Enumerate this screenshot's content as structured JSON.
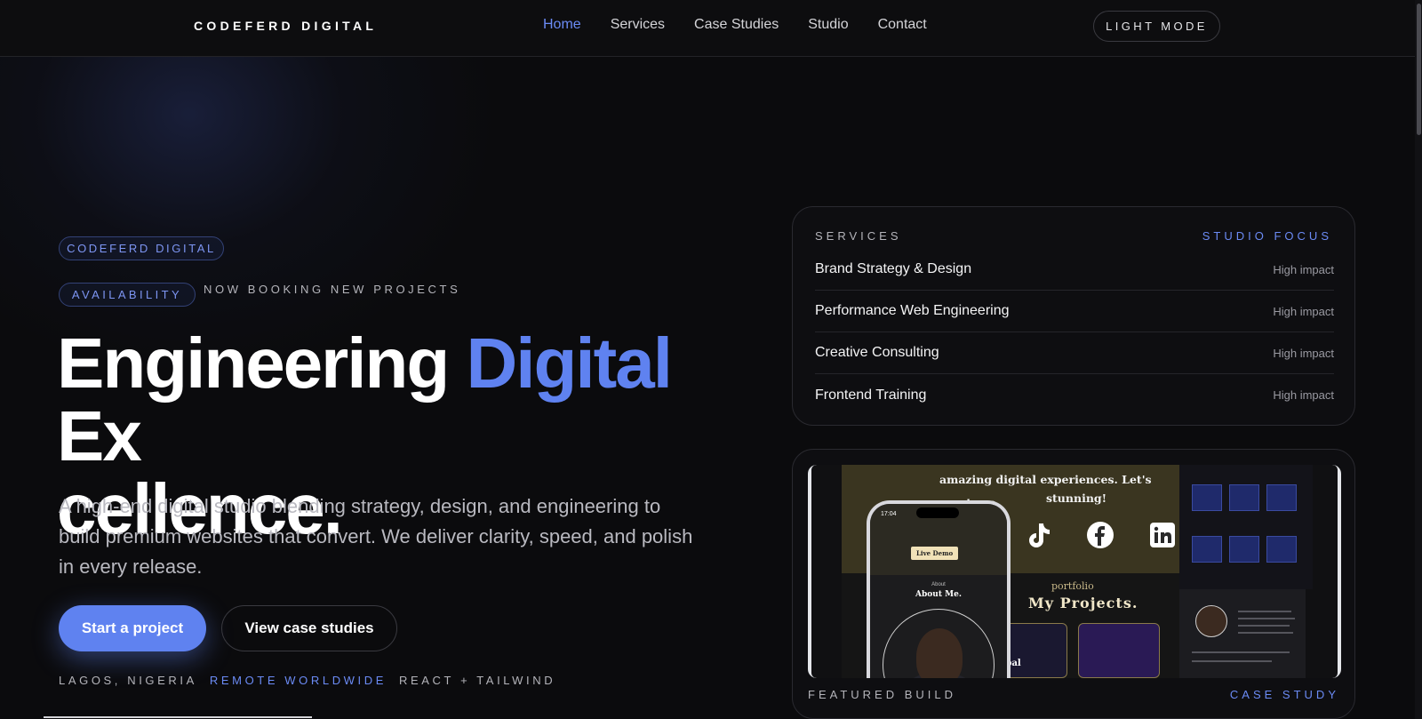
{
  "nav": {
    "brand": "CODEFERD DIGITAL",
    "links": [
      "Home",
      "Services",
      "Case Studies",
      "Studio",
      "Contact"
    ],
    "mode_button": "LIGHT MODE"
  },
  "hero": {
    "pill_brand": "CODEFERD DIGITAL",
    "pill_availability": "AVAILABILITY",
    "booking_status": "NOW BOOKING NEW PROJECTS",
    "headline_part1": "Engineering ",
    "headline_accent": "Digital",
    "headline_part2": " Ex",
    "headline_line2": "cellence.",
    "subcopy": "A high-end digital studio blending strategy, design, and engineering to build premium websites that convert. We deliver clarity, speed, and polish in every release.",
    "primary_cta": "Start a project",
    "secondary_cta": "View case studies",
    "meta_location": "LAGOS, NIGERIA",
    "meta_remote": "REMOTE WORLDWIDE",
    "meta_stack": "REACT + TAILWIND"
  },
  "services_card": {
    "heading": "SERVICES",
    "focus": "STUDIO FOCUS",
    "items": [
      {
        "name": "Brand Strategy & Design",
        "impact": "High impact"
      },
      {
        "name": "Performance Web Engineering",
        "impact": "High impact"
      },
      {
        "name": "Creative Consulting",
        "impact": "High impact"
      },
      {
        "name": "Frontend Training",
        "impact": "High impact"
      }
    ]
  },
  "featured_card": {
    "label": "FEATURED BUILD",
    "link": "CASE STUDY",
    "screenshot": {
      "tagline_1": "amazing digital experiences. Let's create so",
      "tagline_2": "stunning!",
      "portfolio_sub": "portfolio",
      "portfolio_title": "My Projects.",
      "phone_time": "17:04",
      "live_demo": "Live Demo",
      "about_sub": "About",
      "about_title": "About Me.",
      "project_global": "global"
    }
  },
  "colors": {
    "accent": "#5f82f0",
    "background": "#0b0b0d"
  }
}
